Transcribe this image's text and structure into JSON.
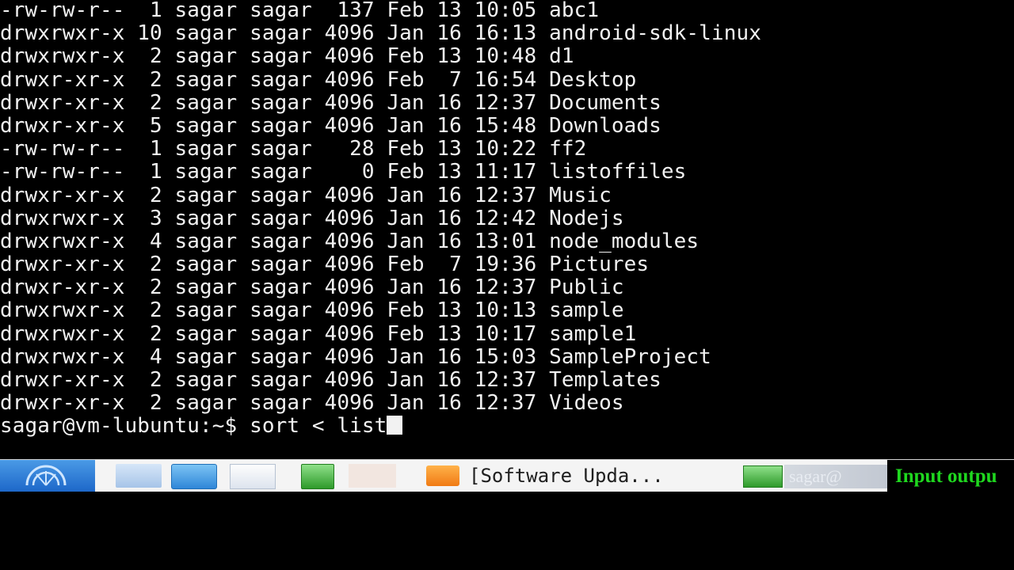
{
  "terminal": {
    "lines": [
      "-rw-rw-r--  1 sagar sagar  137 Feb 13 10:05 abc1",
      "drwxrwxr-x 10 sagar sagar 4096 Jan 16 16:13 android-sdk-linux",
      "drwxrwxr-x  2 sagar sagar 4096 Feb 13 10:48 d1",
      "drwxr-xr-x  2 sagar sagar 4096 Feb  7 16:54 Desktop",
      "drwxr-xr-x  2 sagar sagar 4096 Jan 16 12:37 Documents",
      "drwxr-xr-x  5 sagar sagar 4096 Jan 16 15:48 Downloads",
      "-rw-rw-r--  1 sagar sagar   28 Feb 13 10:22 ff2",
      "-rw-rw-r--  1 sagar sagar    0 Feb 13 11:17 listoffiles",
      "drwxr-xr-x  2 sagar sagar 4096 Jan 16 12:37 Music",
      "drwxrwxr-x  3 sagar sagar 4096 Jan 16 12:42 Nodejs",
      "drwxrwxr-x  4 sagar sagar 4096 Jan 16 13:01 node_modules",
      "drwxr-xr-x  2 sagar sagar 4096 Feb  7 19:36 Pictures",
      "drwxr-xr-x  2 sagar sagar 4096 Jan 16 12:37 Public",
      "drwxrwxr-x  2 sagar sagar 4096 Feb 13 10:13 sample",
      "drwxrwxr-x  2 sagar sagar 4096 Feb 13 10:17 sample1",
      "drwxrwxr-x  4 sagar sagar 4096 Jan 16 15:03 SampleProject",
      "drwxr-xr-x  2 sagar sagar 4096 Jan 16 12:37 Templates",
      "drwxr-xr-x  2 sagar sagar 4096 Jan 16 12:37 Videos"
    ],
    "prompt": "sagar@vm-lubuntu:~$",
    "command": "sort < list"
  },
  "taskbar": {
    "start_icon": "lubuntu-logo-icon",
    "launchers": [
      {
        "icon": "file-manager-icon"
      },
      {
        "icon": "network-icon"
      },
      {
        "icon": "window-icon"
      },
      {
        "icon": "terminal-icon"
      }
    ],
    "window_label": "[Software Upda...",
    "window_icon": "software-updater-icon",
    "blurred_label": "sagar@",
    "caption": "Input outpu"
  },
  "colors": {
    "terminal_bg": "#000000",
    "terminal_fg": "#f2f2f2",
    "taskbar_bg": "#f4f4f4",
    "start_blue": "#2f7fd8",
    "caption_green": "#1fd81f"
  }
}
